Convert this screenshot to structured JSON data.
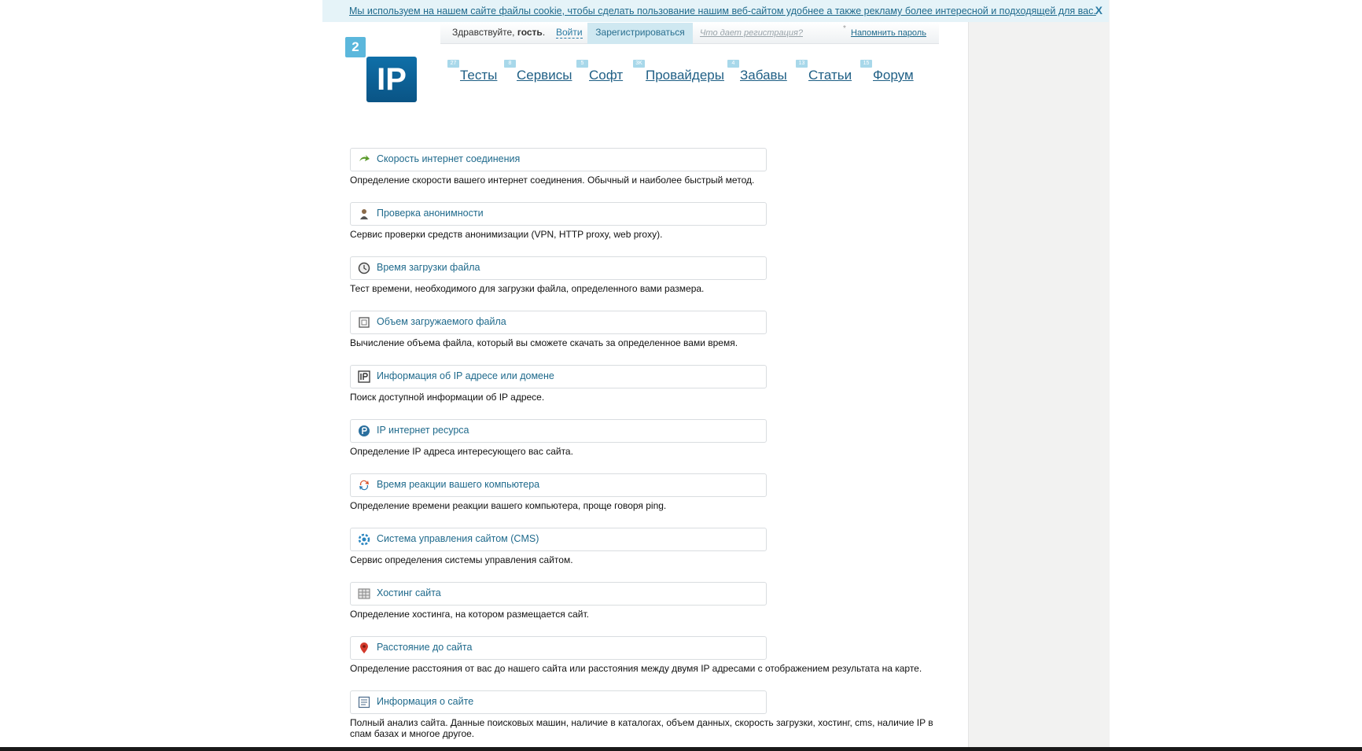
{
  "cookie": {
    "text": "Мы используем на нашем сайте файлы cookie, чтобы сделать пользование нашим веб-сайтом удобнее а также рекламу более интересной и подходящей для вас.",
    "close": "X"
  },
  "userbar": {
    "greeting_prefix": "Здравствуйте, ",
    "guest": "гость",
    "greeting_suffix": ".",
    "login": "Войти",
    "register": "Зарегистрироваться",
    "why": "Что дает регистрация?",
    "star": "*",
    "remind": "Напомнить пароль"
  },
  "logo": {
    "small": "2",
    "big": "IP"
  },
  "nav": [
    {
      "label": "Тесты",
      "badge": "27"
    },
    {
      "label": "Сервисы",
      "badge": "8"
    },
    {
      "label": "Софт",
      "badge": "5"
    },
    {
      "label": "Провайдеры",
      "badge": "3K"
    },
    {
      "label": "Забавы",
      "badge": "4"
    },
    {
      "label": "Статьи",
      "badge": "13"
    },
    {
      "label": "Форум",
      "badge": "15"
    }
  ],
  "services": [
    {
      "title": "Скорость интернет соединения",
      "desc": "Определение скорости вашего интернет соединения. Обычный и наиболее быстрый метод.",
      "icon": "speed-arrow-icon"
    },
    {
      "title": "Проверка анонимности",
      "desc": "Сервис проверки средств анонимизации (VPN, HTTP proxy, web proxy).",
      "icon": "anonymous-user-icon"
    },
    {
      "title": "Время загрузки файла",
      "desc": "Тест времени, необходимого для загрузки файла, определенного вами размера.",
      "icon": "clock-icon"
    },
    {
      "title": "Объем загружаемого файла",
      "desc": "Вычисление объема файла, который вы сможете скачать за определенное вами время.",
      "icon": "file-size-icon"
    },
    {
      "title": "Информация об IP адресе или домене",
      "desc": "Поиск доступной информации об IP адресе.",
      "icon": "ip-box-icon"
    },
    {
      "title": "IP интернет ресурса",
      "desc": "Определение IP адреса интересующего вас сайта.",
      "icon": "ip-circle-icon"
    },
    {
      "title": "Время реакции вашего компьютера",
      "desc": "Определение времени реакции вашего компьютера, проще говоря ping.",
      "icon": "ping-icon"
    },
    {
      "title": "Система управления сайтом (CMS)",
      "desc": "Сервис определения системы управления сайтом.",
      "icon": "cms-gear-icon"
    },
    {
      "title": "Хостинг сайта",
      "desc": "Определение хостинга, на котором размещается сайт.",
      "icon": "hosting-grid-icon"
    },
    {
      "title": "Расстояние до сайта",
      "desc": "Определение расстояния от вас до нашего сайта или расстояния между двумя IP адресами с отображением результата на карте.",
      "icon": "map-pin-icon"
    },
    {
      "title": "Информация о сайте",
      "desc": "Полный анализ сайта. Данные поисковых машин, наличие в каталогах, объем данных, скорость загрузки, хостинг, cms, наличие IP в спам базах и многое другое.",
      "icon": "site-info-icon"
    }
  ]
}
